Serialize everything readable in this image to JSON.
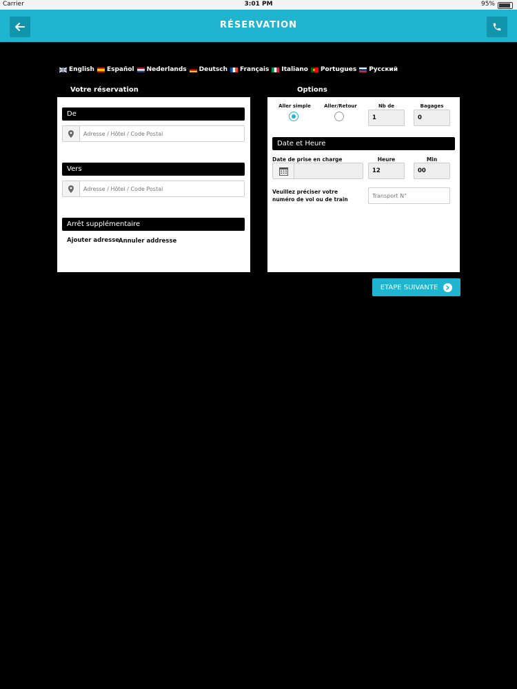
{
  "status_bar": {
    "carrier": "Carrier",
    "time": "3:01 PM",
    "battery": "95%"
  },
  "header": {
    "title": "RÉSERVATION"
  },
  "languages": [
    {
      "label": "English",
      "flag": "gb"
    },
    {
      "label": "Español",
      "flag": "es"
    },
    {
      "label": "Nederlands",
      "flag": "nl"
    },
    {
      "label": "Deutsch",
      "flag": "de"
    },
    {
      "label": "Français",
      "flag": "fr"
    },
    {
      "label": "Italiano",
      "flag": "it"
    },
    {
      "label": "Portugues",
      "flag": "pt"
    },
    {
      "label": "Русский",
      "flag": "ru"
    }
  ],
  "reservation": {
    "title": "Votre réservation",
    "from_label": "De",
    "from_placeholder": "Adresse / Hôtel / Code Postal",
    "to_label": "Vers",
    "to_placeholder": "Adresse / Hôtel / Code Postal",
    "extra_stop_label": "Arrêt supplémentaire",
    "add_address": "Ajouter adresse",
    "cancel_address": "Annuler addresse"
  },
  "options": {
    "title": "Options",
    "one_way": "Aller simple",
    "round_trip": "Aller/Retour",
    "selected_trip": "one_way",
    "passengers_label": "Nb de passagers",
    "passengers_value": "1",
    "baggage_label": "Bagages",
    "baggage_value": "0",
    "date_section": "Date et Heure",
    "pickup_date_label": "Date de prise en charge",
    "hour_label": "Heure",
    "hour_value": "12",
    "min_label": "Min",
    "min_value": "00",
    "flight_label_line1": "Veuillez préciser votre",
    "flight_label_line2": "numéro de vol ou de train",
    "transport_placeholder": "Transport N°"
  },
  "next_button": "ETAPE SUIVANTE",
  "colors": {
    "accent": "#1fb5d0",
    "accent_dark": "#1195ad",
    "background": "#000000"
  }
}
